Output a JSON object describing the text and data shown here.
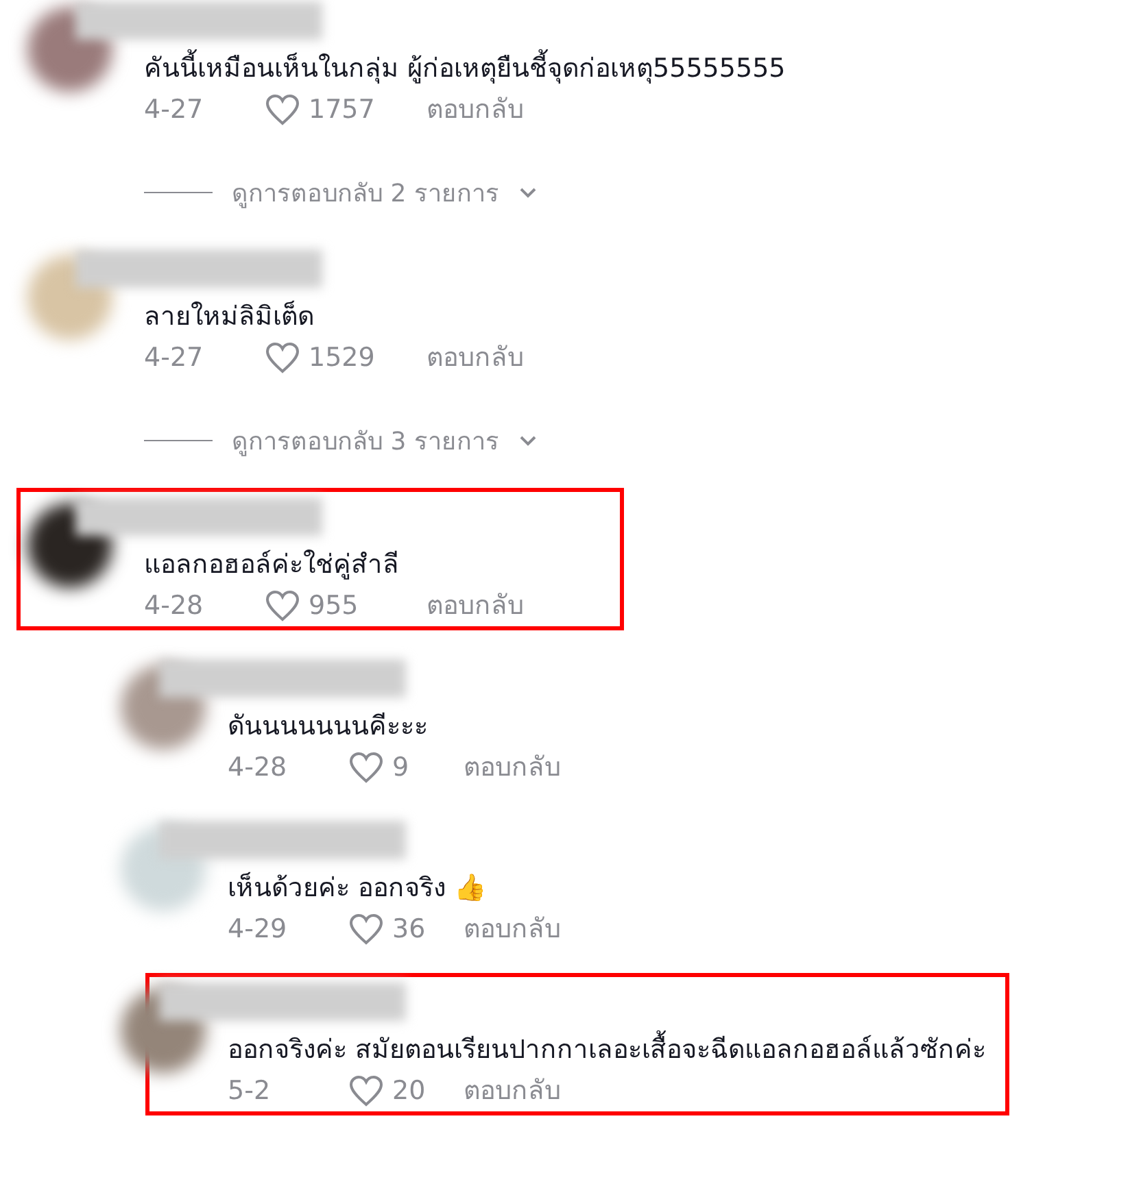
{
  "comments": [
    {
      "text": "คันนี้เหมือนเห็นในกลุ่ม ผู้ก่อเหตุยืนชี้จุดก่อเหตุ55555555",
      "date": "4-27",
      "likes": "1757",
      "reply": "ตอบกลับ",
      "highlighted": false,
      "more_replies": "ดูการตอบกลับ 2 รายการ"
    },
    {
      "text": "ลายใหม่ลิมิเต็ด",
      "date": "4-27",
      "likes": "1529",
      "reply": "ตอบกลับ",
      "highlighted": false,
      "more_replies": "ดูการตอบกลับ 3 รายการ"
    },
    {
      "text": "แอลกอฮอล์ค่ะใช่คู่สำลี",
      "date": "4-28",
      "likes": "955",
      "reply": "ตอบกลับ",
      "highlighted": true,
      "children": [
        {
          "text": "ดันนนนนนนคีะะะ",
          "date": "4-28",
          "likes": "9",
          "reply": "ตอบกลับ",
          "highlighted": false
        },
        {
          "text": "เห็นด้วยค่ะ ออกจริง 👍",
          "date": "4-29",
          "likes": "36",
          "reply": "ตอบกลับ",
          "highlighted": false
        },
        {
          "text": "ออกจริงค่ะ สมัยตอนเรียนปากกาเลอะเสื้อจะฉีดแอลกอฮอล์แล้วซักค่ะ",
          "date": "5-2",
          "likes": "20",
          "reply": "ตอบกลับ",
          "highlighted": true
        }
      ]
    }
  ]
}
